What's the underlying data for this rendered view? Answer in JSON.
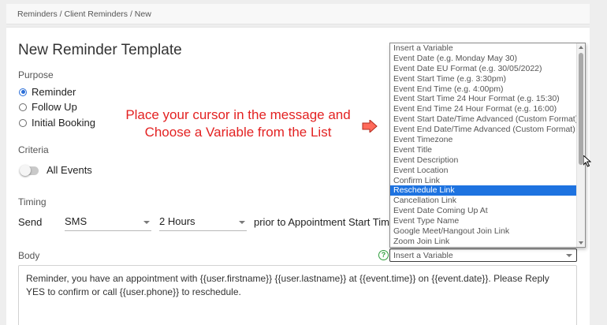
{
  "breadcrumb": "Reminders / Client Reminders / New",
  "page": {
    "title": "New Reminder Template"
  },
  "purpose": {
    "label": "Purpose",
    "options": [
      "Reminder",
      "Follow Up",
      "Initial Booking"
    ],
    "selected": "Reminder"
  },
  "criteria": {
    "label": "Criteria",
    "toggle_label": "All Events"
  },
  "timing": {
    "label": "Timing",
    "send_label": "Send",
    "channel": "SMS",
    "offset": "2 Hours",
    "prior_label": "prior to Appointment Start Tim"
  },
  "body": {
    "label": "Body",
    "text": "Reminder, you have an appointment with {{user.firstname}} {{user.lastname}} at {{event.time}} on {{event.date}}.  Please Reply YES to confirm or call {{user.phone}} to reschedule."
  },
  "instruction": {
    "line1": "Place your cursor in the message and",
    "line2": "Choose a Variable from the List"
  },
  "variable_select": {
    "placeholder": "Insert a Variable",
    "highlighted": "Reschedule Link",
    "options": [
      "Insert a Variable",
      "Event Date (e.g. Monday May 30)",
      "Event Date EU Format (e.g. 30/05/2022)",
      "Event Start Time (e.g. 3:30pm)",
      "Event End Time (e.g. 4:00pm)",
      "Event Start Time 24 Hour Format (e.g. 15:30)",
      "Event End Time 24 Hour Format (e.g. 16:00)",
      "Event Start Date/Time Advanced (Custom Format)",
      "Event End Date/Time Advanced (Custom Format)",
      "Event Timezone",
      "Event Title",
      "Event Description",
      "Event Location",
      "Confirm Link",
      "Reschedule Link",
      "Cancellation Link",
      "Event Date Coming Up At",
      "Event Type Name",
      "Google Meet/Hangout Join Link",
      "Zoom Join Link"
    ]
  },
  "colors": {
    "accent": "#2b6fd8",
    "selection": "#1e73e0",
    "instruction": "#e32222",
    "help_icon": "#2e9e3c"
  },
  "icons": {
    "pointer": "right-arrow-icon",
    "help": "help-icon",
    "cursor": "mouse-cursor-icon"
  }
}
